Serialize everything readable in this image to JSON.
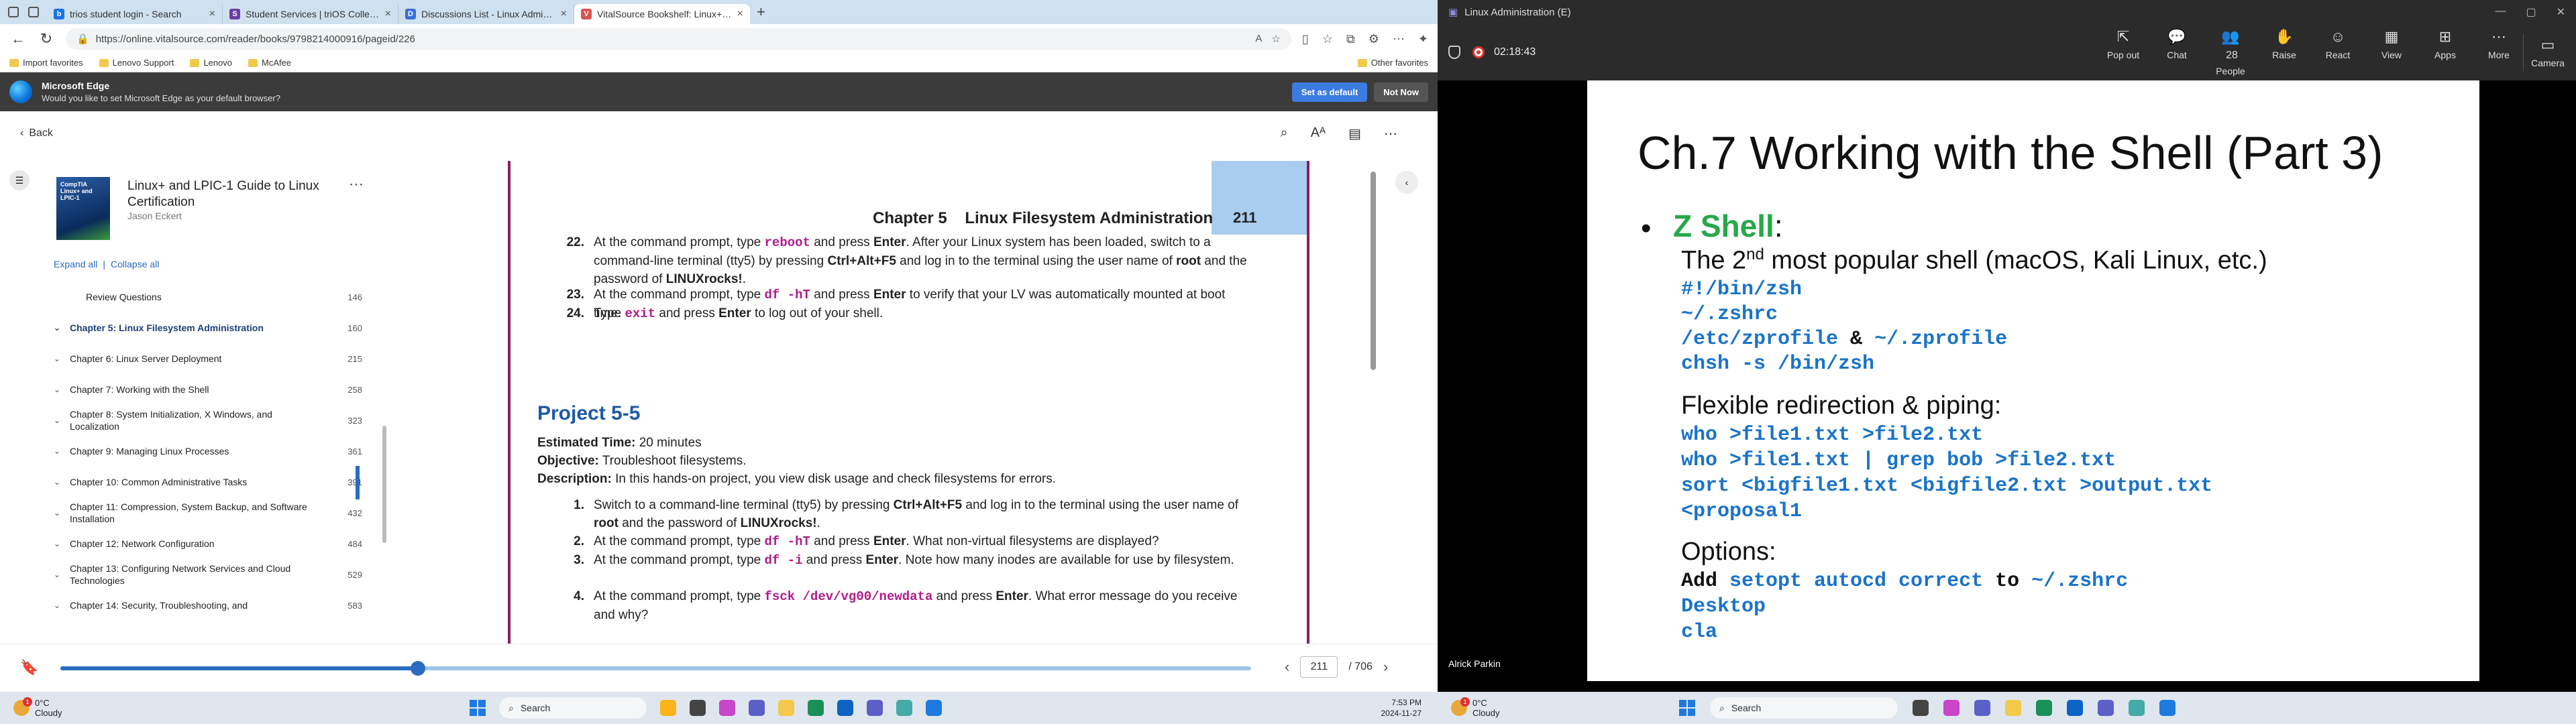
{
  "browser": {
    "tabs": [
      {
        "title": "trios student login - Search",
        "color": "#1a73e8",
        "glyph": "b"
      },
      {
        "title": "Student Services | triOS College",
        "color": "#6b3fa0",
        "glyph": "S"
      },
      {
        "title": "Discussions List - Linux Administ",
        "color": "#3b6fd6",
        "glyph": "D"
      },
      {
        "title": "VitalSource Bookshelf: Linux+ an",
        "color": "#d9534f",
        "glyph": "V"
      }
    ],
    "url": "https://online.vitalsource.com/reader/books/9798214000916/pageid/226",
    "favorites": [
      {
        "label": "Import favorites"
      },
      {
        "label": "Lenovo Support"
      },
      {
        "label": "Lenovo"
      },
      {
        "label": "McAfee"
      }
    ],
    "other_favorites": "Other favorites",
    "infobar": {
      "title": "Microsoft Edge",
      "message": "Would you like to set Microsoft Edge as your default browser?",
      "primary": "Set as default",
      "secondary": "Not Now"
    }
  },
  "reader": {
    "back_label": "Back",
    "book": {
      "title": "Linux+ and LPIC-1 Guide to Linux Certification",
      "author": "Jason Eckert",
      "cover_text": "CompTIA Linux+ and LPIC-1"
    },
    "expand_all": "Expand all",
    "collapse_all": "Collapse all",
    "toc": [
      {
        "label": "Review Questions",
        "page": "146",
        "sub": true
      },
      {
        "label": "Chapter 5: Linux Filesystem Administration",
        "page": "160",
        "active": true
      },
      {
        "label": "Chapter 6: Linux Server Deployment",
        "page": "215"
      },
      {
        "label": "Chapter 7: Working with the Shell",
        "page": "258"
      },
      {
        "label": "Chapter 8: System Initialization, X Windows, and Localization",
        "page": "323"
      },
      {
        "label": "Chapter 9: Managing Linux Processes",
        "page": "361"
      },
      {
        "label": "Chapter 10: Common Administrative Tasks",
        "page": "391"
      },
      {
        "label": "Chapter 11: Compression, System Backup, and Software Installation",
        "page": "432"
      },
      {
        "label": "Chapter 12: Network Configuration",
        "page": "484"
      },
      {
        "label": "Chapter 13: Configuring Network Services and Cloud Technologies",
        "page": "529"
      },
      {
        "label": "Chapter 14: Security, Troubleshooting, and",
        "page": "583"
      }
    ],
    "page_header": "Chapter 5    Linux Filesystem Administration",
    "page_number": "211",
    "steps_top": [
      {
        "n": "22.",
        "parts": [
          [
            "t",
            "At the command prompt, type "
          ],
          [
            "c",
            "reboot"
          ],
          [
            "t",
            " and press "
          ],
          [
            "b",
            "Enter"
          ],
          [
            "t",
            ". After your Linux system has been loaded, switch to a command-line terminal (tty5) by pressing "
          ],
          [
            "b",
            "Ctrl+Alt+F5"
          ],
          [
            "t",
            " and log in to the terminal using the user name of "
          ],
          [
            "b",
            "root"
          ],
          [
            "t",
            " and the password of "
          ],
          [
            "b",
            "LINUXrocks!"
          ],
          [
            "t",
            "."
          ]
        ]
      },
      {
        "n": "23.",
        "parts": [
          [
            "t",
            "At the command prompt, type "
          ],
          [
            "c",
            "df -hT"
          ],
          [
            "t",
            " and press "
          ],
          [
            "b",
            "Enter"
          ],
          [
            "t",
            " to verify that your LV was automatically mounted at boot time."
          ]
        ]
      },
      {
        "n": "24.",
        "parts": [
          [
            "t",
            "Type "
          ],
          [
            "c",
            "exit"
          ],
          [
            "t",
            " and press "
          ],
          [
            "b",
            "Enter"
          ],
          [
            "t",
            " to log out of your shell."
          ]
        ]
      }
    ],
    "project_title": "Project 5-5",
    "est_time_label": "Estimated Time:",
    "est_time": " 20 minutes",
    "objective_label": "Objective:",
    "objective": " Troubleshoot filesystems.",
    "description_label": "Description:",
    "description": " In this hands-on project, you view disk usage and check filesystems for errors.",
    "steps_bottom": [
      {
        "n": "1.",
        "parts": [
          [
            "t",
            "Switch to a command-line terminal (tty5) by pressing "
          ],
          [
            "b",
            "Ctrl+Alt+F5"
          ],
          [
            "t",
            " and log in to the terminal using the user name of "
          ],
          [
            "b",
            "root"
          ],
          [
            "t",
            " and the password of "
          ],
          [
            "b",
            "LINUXrocks!"
          ],
          [
            "t",
            "."
          ]
        ]
      },
      {
        "n": "2.",
        "parts": [
          [
            "t",
            "At the command prompt, type "
          ],
          [
            "c",
            "df -hT"
          ],
          [
            "t",
            " and press "
          ],
          [
            "b",
            "Enter"
          ],
          [
            "t",
            ". What non-virtual filesystems are displayed?"
          ]
        ]
      },
      {
        "n": "3.",
        "parts": [
          [
            "t",
            "At the command prompt, type "
          ],
          [
            "c",
            "df -i"
          ],
          [
            "t",
            " and press "
          ],
          [
            "b",
            "Enter"
          ],
          [
            "t",
            ". Note how many inodes are available for use by filesystem."
          ]
        ]
      },
      {
        "n": "4.",
        "parts": [
          [
            "t",
            "At the command prompt, type "
          ],
          [
            "c",
            "fsck /dev/vg00/newdata"
          ],
          [
            "t",
            " and press "
          ],
          [
            "b",
            "Enter"
          ],
          [
            "t",
            ". What error message do you receive and why?"
          ]
        ]
      }
    ],
    "current_page": "211",
    "total_pages": "/ 706",
    "progress_fraction": 0.3
  },
  "taskbar_left": {
    "weather_temp": "0°C",
    "weather_desc": "Cloudy",
    "search": "Search",
    "time": "7:53 PM",
    "date": "2024-11-27"
  },
  "teams": {
    "window_title": "Linux Administration (E)",
    "timer": "02:18:43",
    "controls": [
      {
        "label": "Pop out",
        "glyph": "⇱"
      },
      {
        "label": "Chat",
        "glyph": "💬"
      },
      {
        "label": "People",
        "glyph": "👥",
        "count": "28"
      },
      {
        "label": "Raise",
        "glyph": "✋"
      },
      {
        "label": "React",
        "glyph": "☺"
      },
      {
        "label": "View",
        "glyph": "▦"
      },
      {
        "label": "Apps",
        "glyph": "⊞"
      },
      {
        "label": "More",
        "glyph": "⋯"
      }
    ],
    "camera_label": "Camera",
    "presenter": "Alrick Parkin",
    "slide": {
      "title": "Ch.7 Working with the Shell (Part 3)",
      "bullet": "Z Shell",
      "bullet_colon": ":",
      "popular_pre": "The 2",
      "popular_sup": "nd",
      "popular_post": " most popular shell (macOS, Kali Linux, etc.)",
      "code1": [
        "#!/bin/zsh",
        "~/.zshrc"
      ],
      "code_zprofile_a": "/etc/zprofile",
      "code_amp": " & ",
      "code_zprofile_b": "~/.zprofile",
      "code_chsh": "chsh -s /bin/zsh",
      "redir_heading": "Flexible redirection & piping:",
      "redir_lines": [
        "who >file1.txt >file2.txt",
        "who >file1.txt | grep bob >file2.txt",
        "sort <bigfile1.txt <bigfile2.txt >output.txt",
        "<proposal1"
      ],
      "options_heading": "Options:",
      "opt_add": "Add ",
      "opt_cmd": "setopt autocd correct",
      "opt_to": " to ",
      "opt_file": "~/.zshrc",
      "opt_lines": [
        "Desktop",
        "cla"
      ]
    }
  },
  "taskbar_right": {
    "weather_temp": "0°C",
    "weather_desc": "Cloudy",
    "search": "Search"
  }
}
